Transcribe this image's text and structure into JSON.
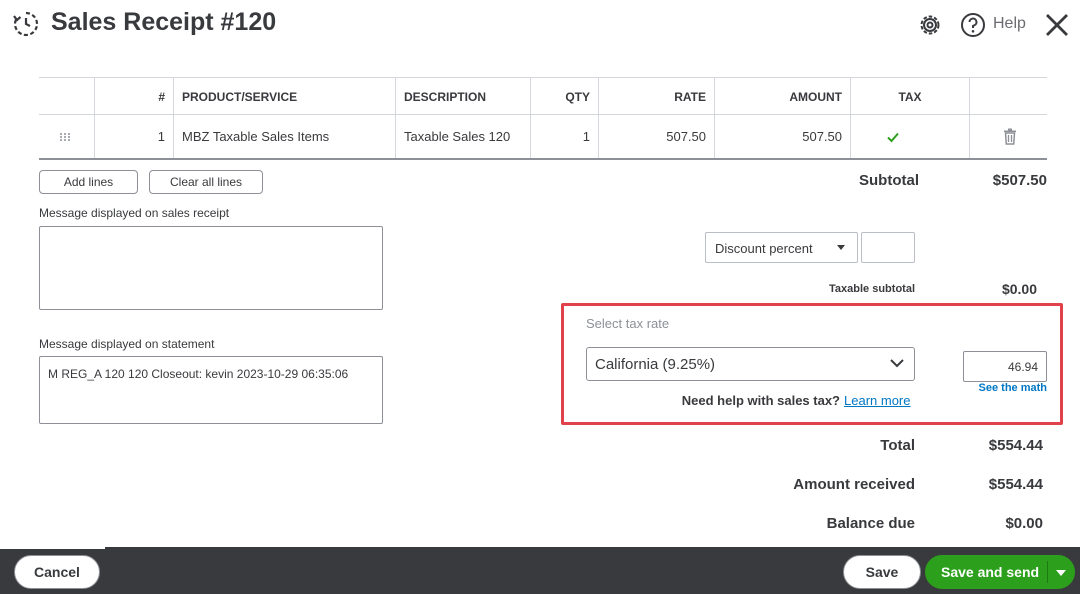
{
  "header": {
    "title": "Sales Receipt #120",
    "help_label": "Help",
    "icons": [
      "recent-transactions-icon",
      "gear-icon",
      "help-icon",
      "close-icon"
    ]
  },
  "table": {
    "columns": [
      "",
      "#",
      "PRODUCT/SERVICE",
      "DESCRIPTION",
      "QTY",
      "RATE",
      "AMOUNT",
      "TAX",
      ""
    ],
    "rows": [
      {
        "num": "1",
        "product": "MBZ Taxable Sales Items",
        "description": "Taxable Sales 120",
        "qty": "1",
        "rate": "507.50",
        "amount": "507.50",
        "taxable": true
      }
    ]
  },
  "actions": {
    "add_lines": "Add lines",
    "clear_all_lines": "Clear all lines"
  },
  "summary": {
    "subtotal_label": "Subtotal",
    "subtotal_value": "$507.50",
    "discount_type": "Discount percent",
    "discount_value": "",
    "taxable_subtotal_label": "Taxable subtotal",
    "taxable_subtotal_value": "$0.00",
    "tax_rate_label": "Select tax rate",
    "tax_rate_selected": "California (9.25%)",
    "tax_amount": "46.94",
    "see_the_math": "See the math",
    "need_help": "Need help with sales tax?",
    "learn_more": "Learn more",
    "total_label": "Total",
    "total_value": "$554.44",
    "amount_received_label": "Amount received",
    "amount_received_value": "$554.44",
    "balance_due_label": "Balance due",
    "balance_due_value": "$0.00"
  },
  "messages": {
    "receipt_label": "Message displayed on sales receipt",
    "receipt_value": "",
    "statement_label": "Message displayed on statement",
    "statement_value": "M REG_A 120 120 Closeout: kevin 2023-10-29 06:35:06"
  },
  "footer": {
    "cancel": "Cancel",
    "save": "Save",
    "save_and_send": "Save and send"
  },
  "colors": {
    "primary_green": "#2ca01c",
    "link_blue": "#0077c5",
    "highlight_red": "#e0414b",
    "footer_bg": "#393a3d"
  }
}
